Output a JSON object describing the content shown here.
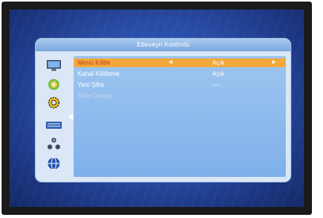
{
  "menu": {
    "title": "Ebeveyn Kontrolü",
    "items": [
      {
        "label": "Menü Kilitle",
        "value": "Açık",
        "selected": true
      },
      {
        "label": "Kanal Kilitleme",
        "value": "Açık"
      },
      {
        "label": "Yeni Şifre",
        "value": "----"
      },
      {
        "label": "Şifre Onayla",
        "value": ""
      }
    ]
  },
  "sidebar": {
    "icons": [
      "tv-icon",
      "disc-icon",
      "gear-icon",
      "keyboard-icon",
      "network-icon",
      "globe-icon"
    ],
    "active": "gear-icon"
  },
  "colors": {
    "screen": "#2a4ea8",
    "panel": "#dbe7f6",
    "title_bar": "#7aa6dd",
    "content": "#8fbbee",
    "selected_row": "#f2a93a",
    "selected_text": "#c0392b"
  }
}
